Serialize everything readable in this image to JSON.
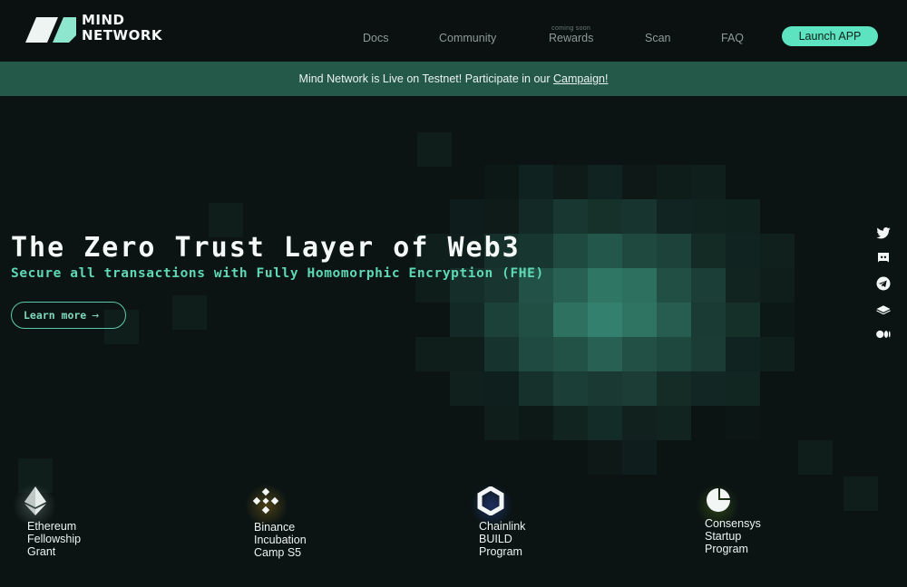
{
  "brand": {
    "line1": "MIND",
    "line2": "NETWORK"
  },
  "nav": {
    "docs": "Docs",
    "community": "Community",
    "rewards_badge": "coming soon",
    "rewards": "Rewards",
    "scan": "Scan",
    "faq": "FAQ",
    "launch": "Launch APP"
  },
  "banner": {
    "text": "Mind Network is Live on Testnet! Participate in our ",
    "link": "Campaign!"
  },
  "hero": {
    "title": "The Zero Trust Layer of Web3",
    "subtitle": "Secure all transactions with Fully Homomorphic Encryption (FHE)",
    "cta": "Learn more"
  },
  "social": [
    "twitter-icon",
    "discord-icon",
    "telegram-icon",
    "gitbook-icon",
    "medium-icon"
  ],
  "partners": [
    {
      "icon": "ethereum-icon",
      "label": "Ethereum\nFellowship\nGrant"
    },
    {
      "icon": "binance-icon",
      "label": "Binance\nIncubation\nCamp S5"
    },
    {
      "icon": "chainlink-icon",
      "label": "Chainlink\nBUILD\nProgram"
    },
    {
      "icon": "consensys-icon",
      "label": "Consensys\nStartup\nProgram"
    }
  ],
  "colors": {
    "accent": "#5ee3c1",
    "banner": "#245848",
    "background": "#0b1413",
    "subtitle": "#5fd9b3"
  }
}
